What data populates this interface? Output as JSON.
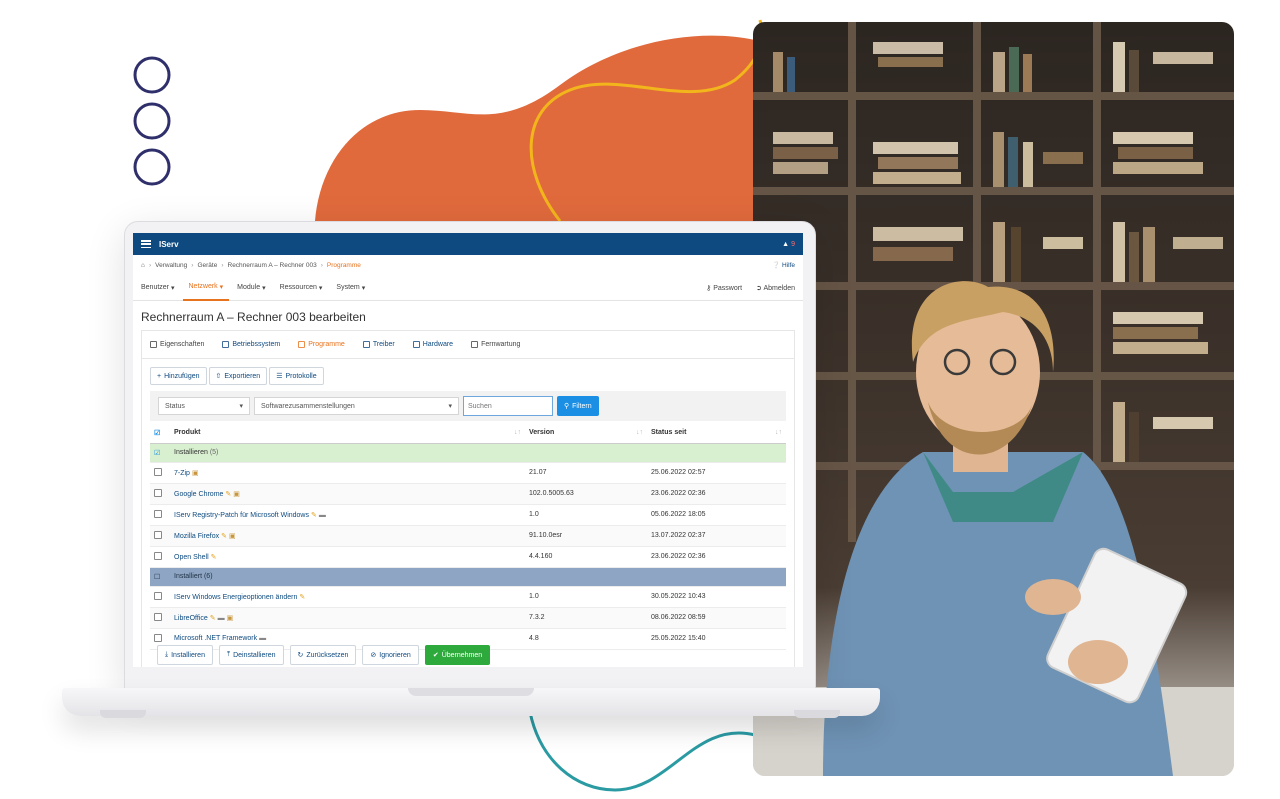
{
  "app": {
    "name": "IServ",
    "notifications": "9"
  },
  "breadcrumbs": [
    "Verwaltung",
    "Geräte",
    "Rechnerraum A – Rechner 003",
    "Programme"
  ],
  "help_label": "Hilfe",
  "nav": {
    "items": [
      "Benutzer",
      "Netzwerk",
      "Module",
      "Ressourcen",
      "System"
    ],
    "active": "Netzwerk",
    "password_label": "Passwort",
    "logout_label": "Abmelden"
  },
  "page_title": "Rechnerraum A – Rechner 003 bearbeiten",
  "tabs": [
    "Eigenschaften",
    "Betriebssystem",
    "Programme",
    "Treiber",
    "Hardware",
    "Fernwartung"
  ],
  "toolbar": {
    "add": "Hinzufügen",
    "export": "Exportieren",
    "logs": "Protokolle"
  },
  "filters": {
    "status": "Status",
    "collections": "Softwarezusammenstellungen",
    "search_placeholder": "Suchen",
    "filter_button": "Filtern"
  },
  "table": {
    "headers": [
      "Produkt",
      "Version",
      "Status seit"
    ],
    "group_install": {
      "label": "Installieren",
      "count": "(5)"
    },
    "group_installed": {
      "label": "Installiert",
      "count": "(6)"
    },
    "rows_install": [
      {
        "name": "7-Zip",
        "version": "21.07",
        "since": "25.06.2022 02:57"
      },
      {
        "name": "Google Chrome",
        "version": "102.0.5005.63",
        "since": "23.06.2022 02:36"
      },
      {
        "name": "IServ Registry-Patch für Microsoft Windows",
        "version": "1.0",
        "since": "05.06.2022 18:05"
      },
      {
        "name": "Mozilla Firefox",
        "version": "91.10.0esr",
        "since": "13.07.2022 02:37"
      },
      {
        "name": "Open Shell",
        "version": "4.4.160",
        "since": "23.06.2022 02:36"
      }
    ],
    "rows_installed": [
      {
        "name": "IServ Windows Energieoptionen ändern",
        "version": "1.0",
        "since": "30.05.2022 10:43"
      },
      {
        "name": "LibreOffice",
        "version": "7.3.2",
        "since": "08.06.2022 08:59"
      },
      {
        "name": "Microsoft .NET Framework",
        "version": "4.8",
        "since": "25.05.2022 15:40"
      }
    ]
  },
  "footer": {
    "install": "Installieren",
    "uninstall": "Deinstallieren",
    "reset": "Zurücksetzen",
    "ignore": "Ignorieren",
    "apply": "Übernehmen"
  },
  "colors": {
    "topbar": "#0e4a80",
    "accent": "#e8731e",
    "blob": "#e06a3c",
    "apply": "#2eaa3c"
  }
}
